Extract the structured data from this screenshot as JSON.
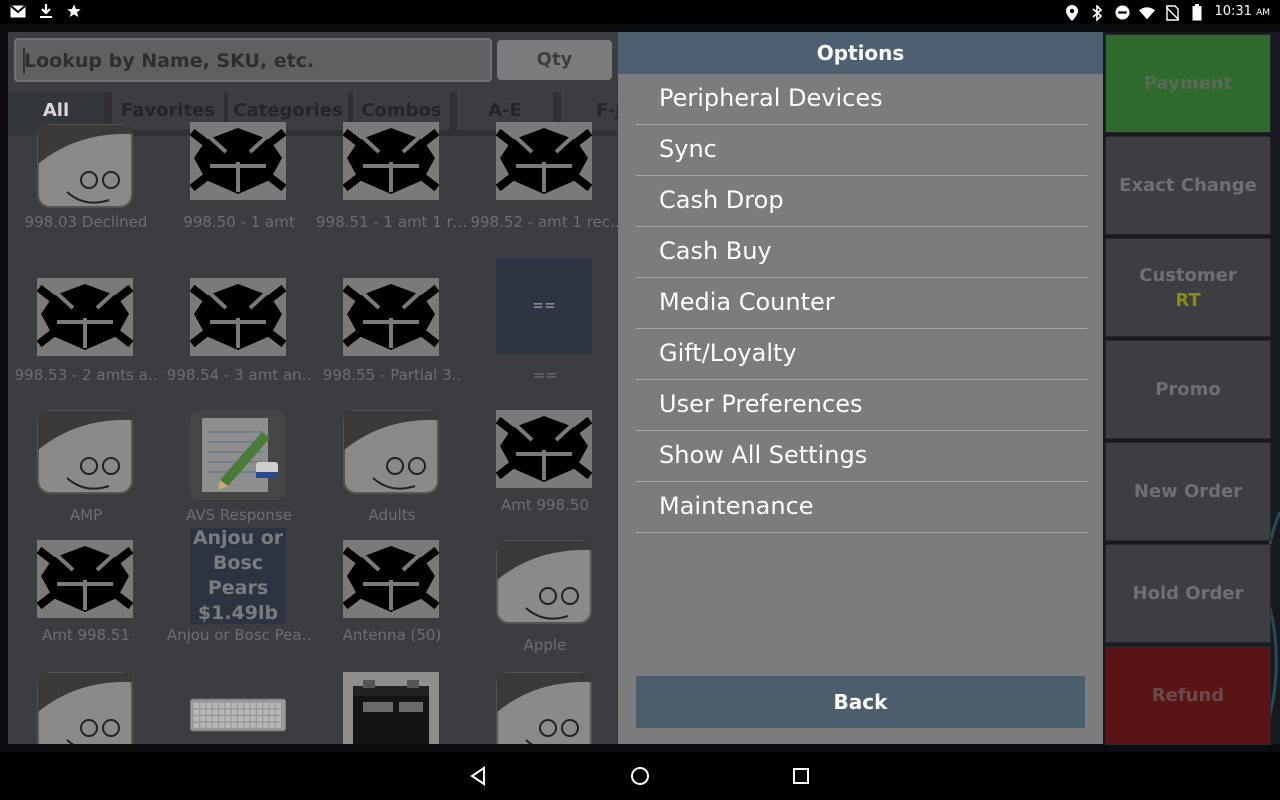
{
  "status_bar": {
    "time": "10:31",
    "ampm": "AM",
    "icons_left": [
      "gmail-icon",
      "download-icon",
      "star-icon"
    ],
    "icons_right": [
      "location-icon",
      "bluetooth-icon",
      "do-not-disturb-icon",
      "wifi-icon",
      "no-sim-icon",
      "battery-icon"
    ]
  },
  "search": {
    "placeholder": "Lookup by Name, SKU, etc.",
    "qty_label": "Qty"
  },
  "tabs": [
    {
      "label": "All",
      "active": true
    },
    {
      "label": "Favorites"
    },
    {
      "label": "Categories"
    },
    {
      "label": "Combos"
    },
    {
      "label": "A-E"
    },
    {
      "label": "F-J"
    }
  ],
  "products": [
    {
      "label": "998.03 Declined",
      "image": "face"
    },
    {
      "label": "998.50 - 1 amt",
      "image": "logo"
    },
    {
      "label": "998.51 - 1 amt 1 re..",
      "image": "logo"
    },
    {
      "label": "998.52 - amt 1 rec..",
      "image": "logo"
    },
    {
      "label": "998.53 - 2 amts a..",
      "image": "logo"
    },
    {
      "label": "998.54 - 3 amt an..",
      "image": "logo"
    },
    {
      "label": "998.55 - Partial 3..",
      "image": "logo"
    },
    {
      "label": "==",
      "image": "text",
      "tile_text": "=="
    },
    {
      "label": "AMP",
      "image": "face"
    },
    {
      "label": "AVS Response",
      "image": "notepad"
    },
    {
      "label": "Adults",
      "image": "face"
    },
    {
      "label": "Amt 998.50",
      "image": "logo"
    },
    {
      "label": "Amt 998.51",
      "image": "logo"
    },
    {
      "label": "Anjou or Bosc Pea..",
      "image": "text",
      "tile_text": "Anjou or Bosc Pears $1.49lb"
    },
    {
      "label": "Antenna (50)",
      "image": "logo"
    },
    {
      "label": "Apple",
      "image": "face"
    },
    {
      "label": "",
      "image": "face"
    },
    {
      "label": "",
      "image": "keyboard"
    },
    {
      "label": "",
      "image": "battery"
    },
    {
      "label": "",
      "image": "face"
    }
  ],
  "options": {
    "title": "Options",
    "items": [
      "Peripheral Devices",
      "Sync",
      "Cash Drop",
      "Cash Buy",
      "Media Counter",
      "Gift/Loyalty",
      "User Preferences",
      "Show All Settings",
      "Maintenance"
    ],
    "back_label": "Back"
  },
  "actions": {
    "payment": "Payment",
    "exact_change": "Exact Change",
    "customer": "Customer",
    "customer_value": "RT",
    "promo": "Promo",
    "new_order": "New Order",
    "hold_order": "Hold Order",
    "refund": "Refund"
  },
  "colors": {
    "payment": "#2f6a2d",
    "refund": "#5a1416",
    "header": "#4c6072",
    "customer_value": "#8a8a18"
  },
  "nav": [
    "back-icon",
    "home-icon",
    "recents-icon"
  ]
}
